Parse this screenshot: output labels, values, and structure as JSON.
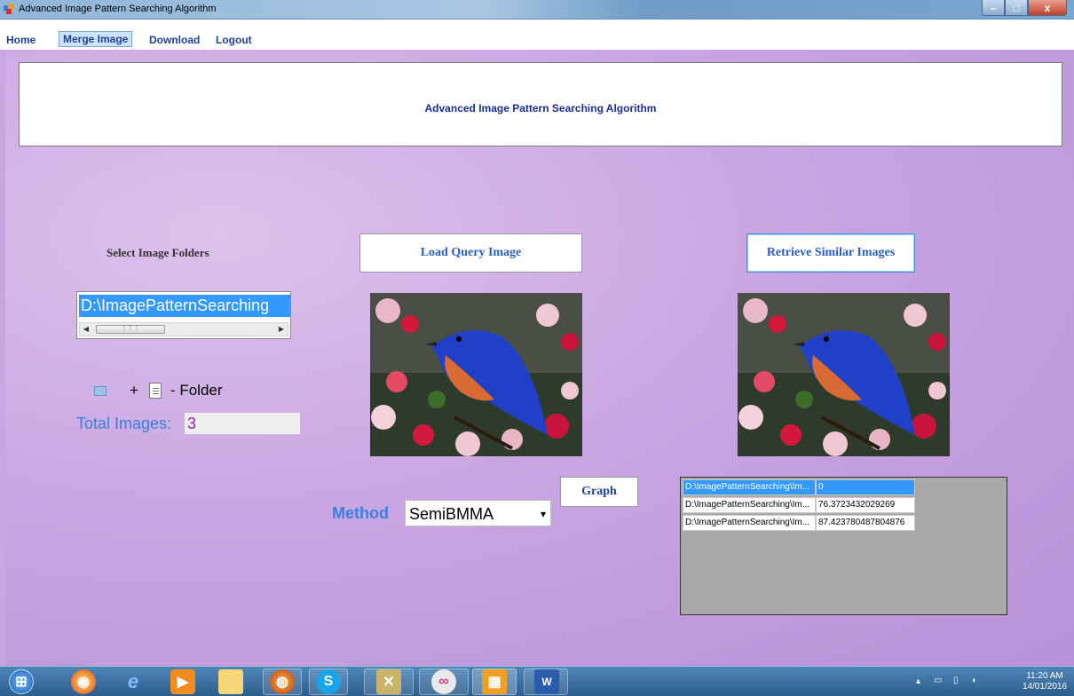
{
  "window": {
    "title": "Advanced Image Pattern Searching Algorithm",
    "minimize": "–",
    "maximize": "□",
    "close": "x"
  },
  "menu": {
    "items": [
      "Home",
      "Merge Image",
      "Download",
      "Logout"
    ],
    "active": "Merge Image"
  },
  "header": {
    "title": "Advanced Image Pattern Searching Algorithm"
  },
  "left": {
    "select_label": "Select Image Folders",
    "folder_list": [
      "D:\\ImagePatternSearching"
    ],
    "folder_hint_plus": "+",
    "folder_hint_text": "- Folder",
    "total_label": "Total Images:",
    "total_value": "3"
  },
  "buttons": {
    "load_query": "Load Query Image",
    "retrieve": "Retrieve Similar Images",
    "graph": "Graph"
  },
  "method": {
    "label": "Method",
    "selected": "SemiBMMA"
  },
  "results": {
    "rows": [
      {
        "path": "D:\\ImagePatternSearching\\Im...",
        "score": "0"
      },
      {
        "path": "D:\\ImagePatternSearching\\Im...",
        "score": "76.3723432029269"
      },
      {
        "path": "D:\\ImagePatternSearching\\Im...",
        "score": "87.423780487804876"
      }
    ]
  },
  "taskbar": {
    "time": "11:20 AM",
    "date": "14/01/2016"
  },
  "colors": {
    "accent_blue": "#3a7fe0",
    "selection": "#3399ff",
    "background_purple": "#c9a6e0"
  }
}
